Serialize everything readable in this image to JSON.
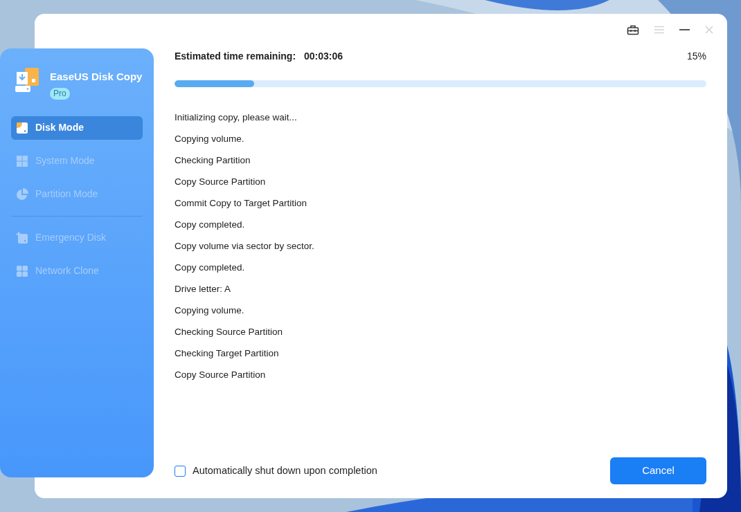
{
  "app": {
    "title": "EaseUS Disk Copy",
    "badge": "Pro"
  },
  "nav": [
    {
      "label": "Disk Mode",
      "selected": true,
      "disabled": false
    },
    {
      "label": "System Mode",
      "selected": false,
      "disabled": true
    },
    {
      "label": "Partition Mode",
      "selected": false,
      "disabled": true
    },
    {
      "label": "Emergency Disk",
      "selected": false,
      "disabled": true
    },
    {
      "label": "Network Clone",
      "selected": false,
      "disabled": true
    }
  ],
  "progress": {
    "label": "Estimated time remaining:",
    "time": "00:03:06",
    "percent": "15%",
    "level": 0.15
  },
  "log": [
    "Initializing copy, please wait...",
    "Copying volume.",
    "Checking Partition",
    "Copy Source Partition",
    "Commit Copy to Target Partition",
    "Copy completed.",
    "Copy volume via sector by sector.",
    "Copy completed.",
    "Drive letter: A",
    "Copying volume.",
    "Checking Source Partition",
    "Checking Target Partition",
    "Copy Source Partition"
  ],
  "shutdown_option": {
    "label": "Automatically shut down upon completion",
    "checked": false
  },
  "cancel_button": "Cancel"
}
